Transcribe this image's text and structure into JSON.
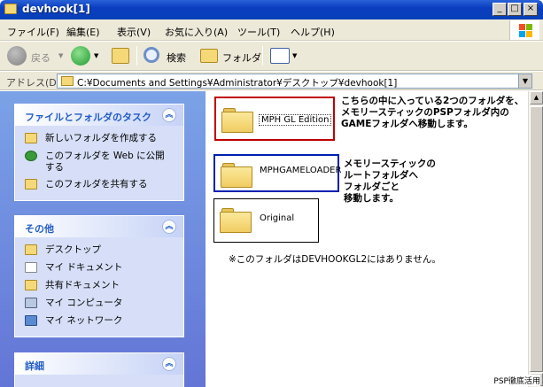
{
  "window": {
    "title": "devhook[1]"
  },
  "menu": [
    "ファイル(F)",
    "編集(E)",
    "表示(V)",
    "お気に入り(A)",
    "ツール(T)",
    "ヘルプ(H)"
  ],
  "toolbar": {
    "back": "戻る",
    "search": "検索",
    "folders": "フォルダ"
  },
  "address": {
    "label": "アドレス(D)",
    "path": "C:¥Documents and Settings¥Administrator¥デスクトップ¥devhook[1]"
  },
  "tasks_panel": {
    "title": "ファイルとフォルダのタスク",
    "items": [
      "新しいフォルダを作成する",
      "このフォルダを Web に公開\nする",
      "このフォルダを共有する"
    ]
  },
  "places_panel": {
    "title": "その他",
    "items": [
      "デスクトップ",
      "マイ ドキュメント",
      "共有ドキュメント",
      "マイ コンピュータ",
      "マイ ネットワーク"
    ]
  },
  "details_panel": {
    "title": "詳細"
  },
  "folders": [
    {
      "name": "MPH GL Edition",
      "border": "#c00000"
    },
    {
      "name": "MPHGAMELOADER",
      "border": "#0020b0"
    },
    {
      "name": "Original",
      "border": "#000000"
    }
  ],
  "annotations": {
    "red": "こちらの中に入っている2つのフォルダを、\nメモリースティックのPSPフォルダ内の\nGAMEフォルダへ移動します。",
    "blue": "メモリースティックの\nルートフォルダへ\nフォルダごと\n移動します。"
  },
  "note": "※このフォルダはDEVHOOKGL2にはありません。",
  "credit": "PSP徹底活用"
}
